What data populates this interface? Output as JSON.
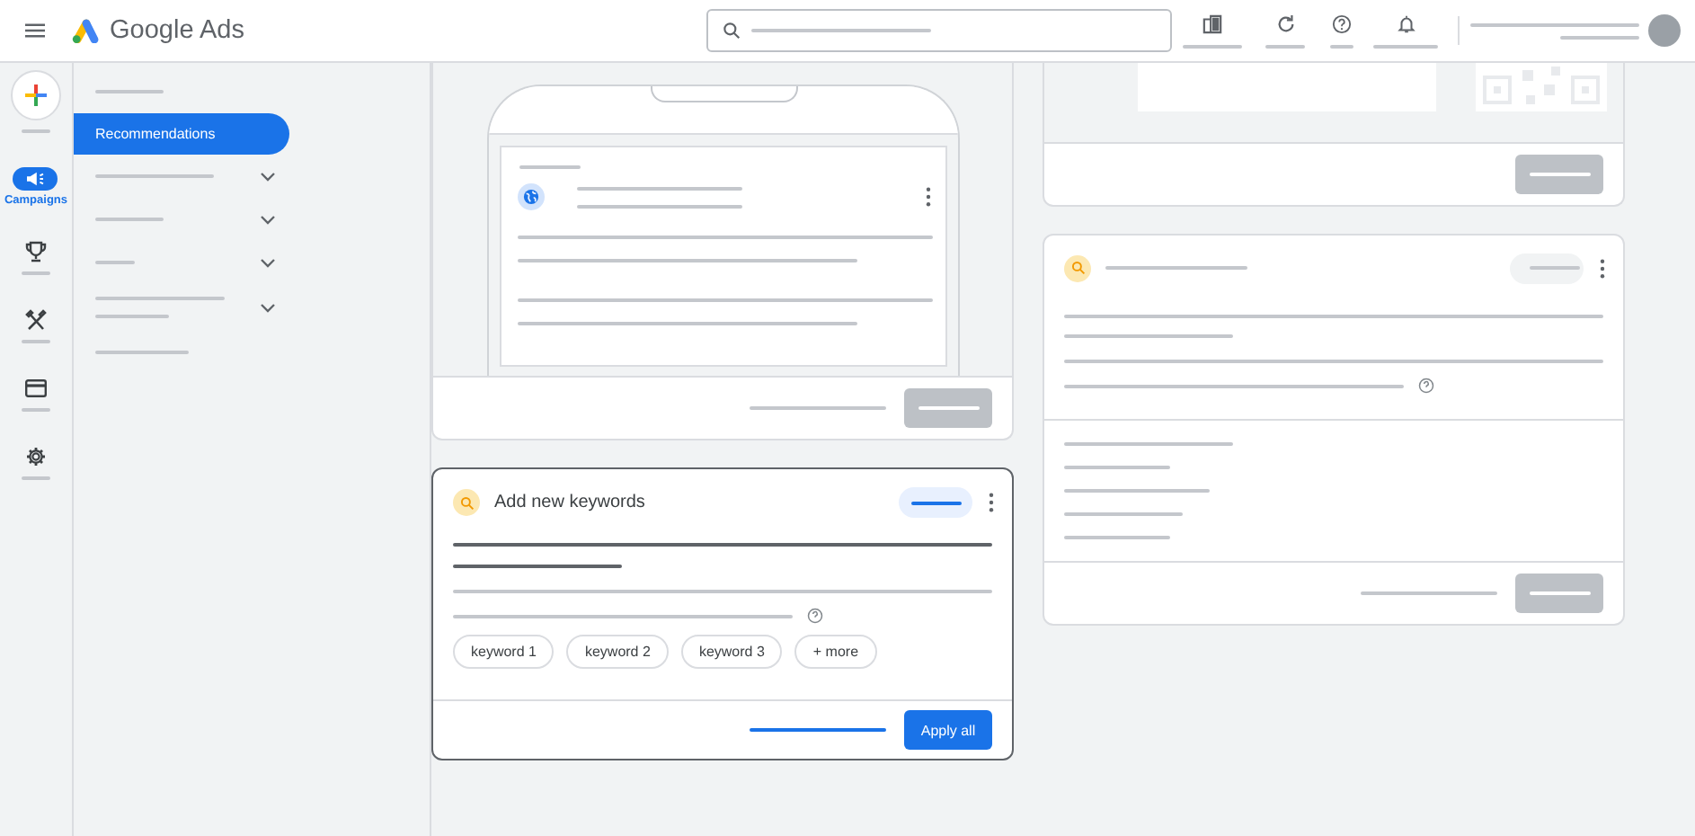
{
  "header": {
    "title": "Google Ads"
  },
  "rail": [
    {
      "kind": "create"
    },
    {
      "kind": "campaigns",
      "label": "Campaigns",
      "selected": true
    },
    {
      "kind": "goals",
      "selected": false
    },
    {
      "kind": "tools",
      "selected": false
    },
    {
      "kind": "billing",
      "selected": false
    },
    {
      "kind": "admin",
      "selected": false
    }
  ],
  "nav": [
    {
      "kind": "link",
      "selected": false
    },
    {
      "kind": "link",
      "label": "Recommendations",
      "selected": true
    },
    {
      "kind": "group",
      "selected": false,
      "expanded": false
    },
    {
      "kind": "group_short",
      "selected": false,
      "expanded": false
    },
    {
      "kind": "group_tiny",
      "selected": false,
      "expanded": false
    },
    {
      "kind": "group_two_line",
      "selected": false,
      "expanded": false
    },
    {
      "kind": "link",
      "selected": false
    }
  ],
  "keywords_card": {
    "title": "Add new keywords",
    "chips": [
      "keyword 1",
      "keyword 2",
      "keyword 3",
      "+ more"
    ],
    "action": "Apply all"
  }
}
